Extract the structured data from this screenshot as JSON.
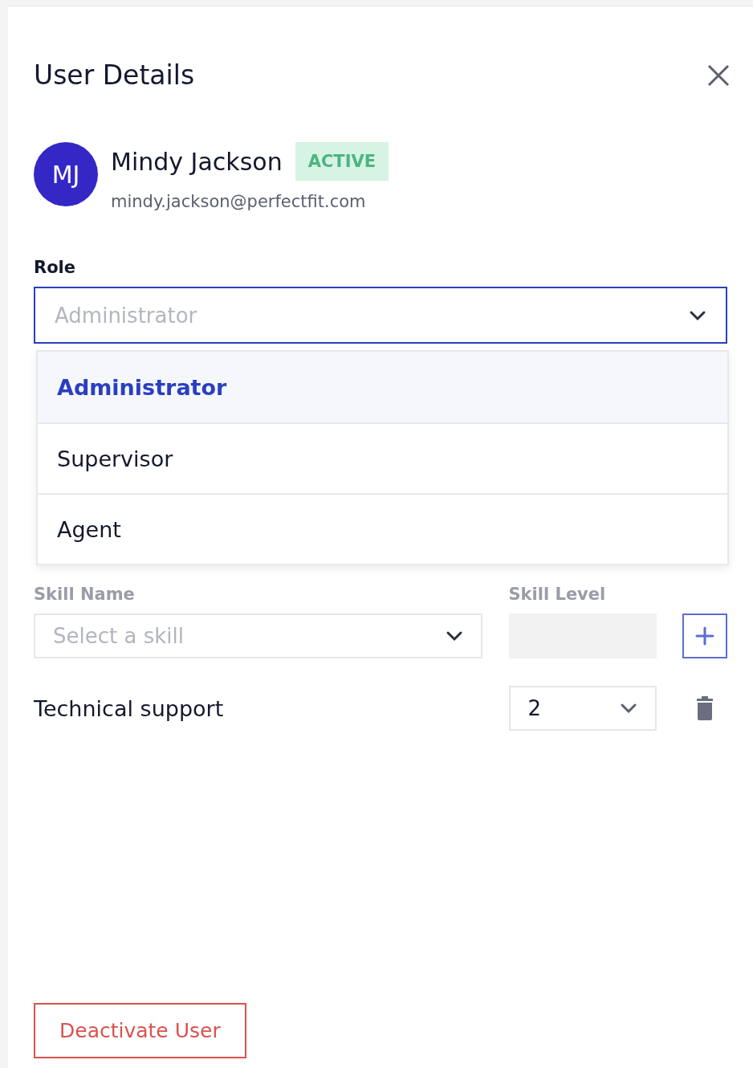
{
  "panel": {
    "title": "User Details"
  },
  "user": {
    "initials": "MJ",
    "name": "Mindy Jackson",
    "status": "ACTIVE",
    "email": "mindy.jackson@perfectfit.com"
  },
  "role": {
    "label": "Role",
    "placeholder": "Administrator",
    "expanded": true,
    "options": [
      {
        "label": "Administrator",
        "selected": true
      },
      {
        "label": "Supervisor",
        "selected": false
      },
      {
        "label": "Agent",
        "selected": false
      }
    ]
  },
  "skills": {
    "name_label": "Skill Name",
    "level_label": "Skill Level",
    "name_placeholder": "Select a skill",
    "items": [
      {
        "name": "Technical support",
        "level": "2"
      }
    ]
  },
  "footer_button": "Deactivate User"
}
